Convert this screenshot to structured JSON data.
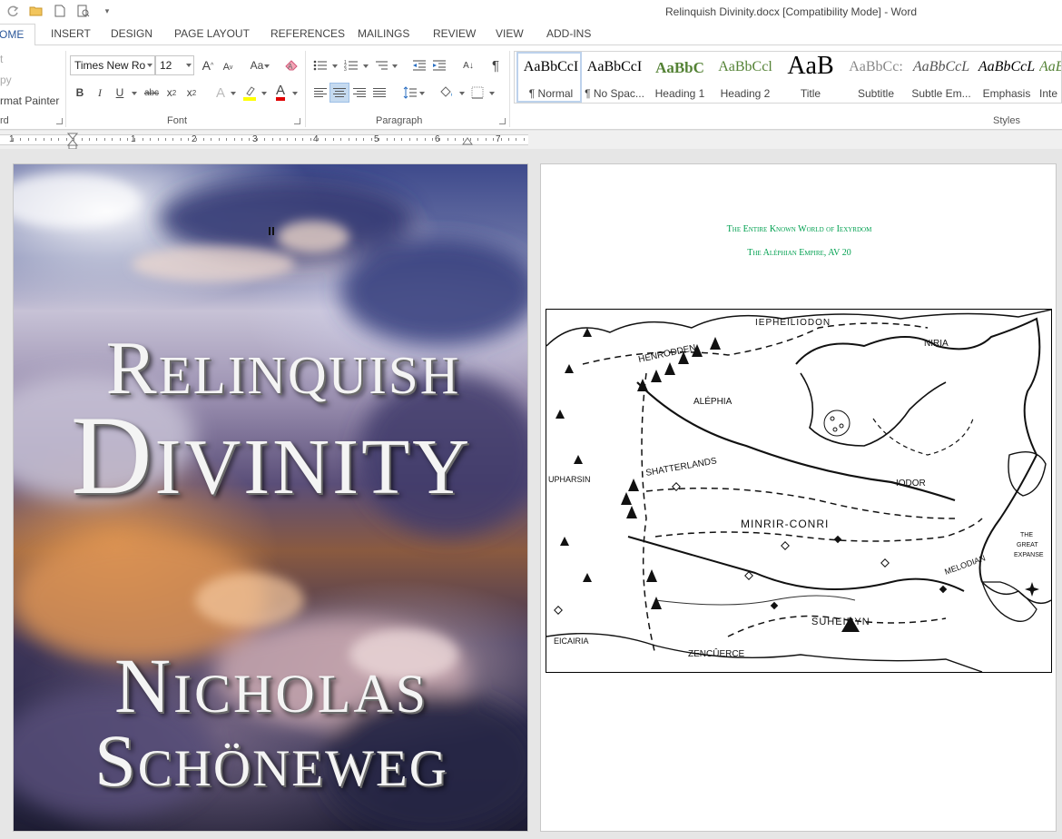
{
  "window": {
    "title": "Relinquish Divinity.docx [Compatibility Mode] - Word"
  },
  "quick_access": [
    {
      "icon": "save-icon"
    },
    {
      "icon": "redo-icon"
    },
    {
      "icon": "open-icon"
    },
    {
      "icon": "new-document-icon"
    },
    {
      "icon": "print-preview-icon"
    },
    {
      "icon": "customize-qat-icon"
    }
  ],
  "tabs": [
    "HOME",
    "INSERT",
    "DESIGN",
    "PAGE LAYOUT",
    "REFERENCES",
    "MAILINGS",
    "REVIEW",
    "VIEW",
    "ADD-INS"
  ],
  "tabs_display": [
    "OME",
    "INSERT",
    "DESIGN",
    "PAGE LAYOUT",
    "REFERENCES",
    "MAILINGS",
    "REVIEW",
    "VIEW",
    "ADD-INS"
  ],
  "active_tab": "HOME",
  "ribbon": {
    "clipboard": {
      "cut": "t",
      "copy": "py",
      "format_painter": "rmat Painter",
      "label": "rd"
    },
    "font": {
      "name": "Times New Ro",
      "size": "12",
      "label": "Font",
      "grow": "A",
      "shrink": "A",
      "change_case": "Aa",
      "bold": "B",
      "italic": "I",
      "underline": "U",
      "strikethrough": "abc",
      "subscript": "x",
      "superscript": "x",
      "sub_mark": "2",
      "sup_mark": "2",
      "text_effects": "A",
      "font_color": "A",
      "highlight_color": "#ffff00",
      "font_color_value": "#e00000"
    },
    "paragraph": {
      "label": "Paragraph",
      "show_marks": "¶",
      "sort": "A↓"
    },
    "styles": {
      "label": "Styles",
      "items": [
        {
          "preview": "AaBbCcI",
          "label": "¶ Normal"
        },
        {
          "preview": "AaBbCcI",
          "label": "¶ No Spac..."
        },
        {
          "preview": "AaBbC",
          "label": "Heading 1"
        },
        {
          "preview": "AaBbCcl",
          "label": "Heading 2"
        },
        {
          "preview": "AaB",
          "label": "Title"
        },
        {
          "preview": "AaBbCc:",
          "label": "Subtitle"
        },
        {
          "preview": "AaBbCcL",
          "label": "Subtle Em..."
        },
        {
          "preview": "AaBbCcL",
          "label": "Emphasis"
        },
        {
          "preview": "AaBb",
          "label": "Inte"
        }
      ],
      "active": "¶ Normal",
      "heading_color": "#548235"
    }
  },
  "ruler": {
    "numbers": [
      "1",
      "1",
      "2",
      "3",
      "4",
      "5",
      "6",
      "7"
    ]
  },
  "document": {
    "cover": {
      "title_line1": "Relinquish",
      "title_line2": "Divinity",
      "author_line1": "Nicholas",
      "author_line2": "Schöneweg"
    },
    "map_page": {
      "heading1": "The Entire Known World of Iexyrdom",
      "heading2": "The Aléphian Empire, AV 20",
      "heading_color": "#00a050",
      "map_labels": [
        "IEPHEILIODON",
        "HENRODDEN",
        "NIRIA",
        "ALÉPHIA",
        "SHATTERLANDS",
        "UPHARSIN",
        "IODOR",
        "MINRIR-CONRI",
        "THE",
        "GREAT",
        "EXPANSE",
        "MELODIAN",
        "SUHEIRYN",
        "EICAIRIA",
        "ZENCÛERCE"
      ]
    }
  }
}
